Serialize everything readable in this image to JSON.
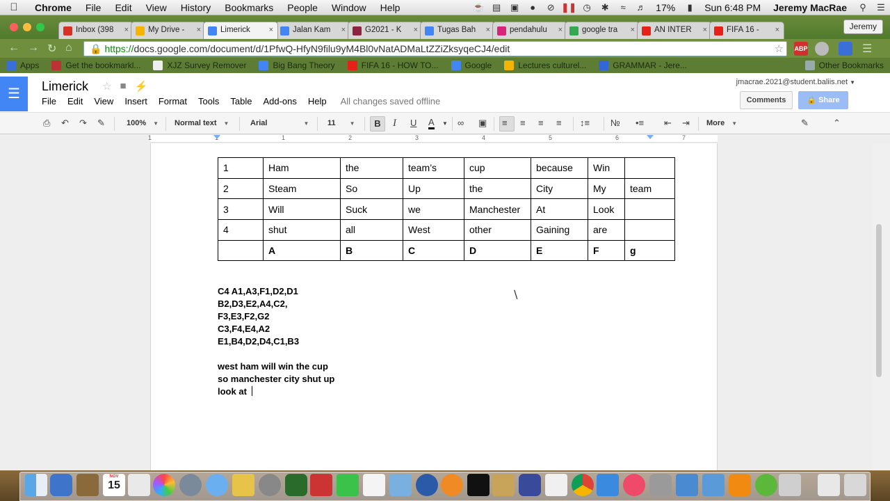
{
  "menubar": {
    "app": "Chrome",
    "items": [
      "File",
      "Edit",
      "View",
      "History",
      "Bookmarks",
      "People",
      "Window",
      "Help"
    ],
    "battery": "17%",
    "clock": "Sun 6:48 PM",
    "user": "Jeremy MacRae"
  },
  "tabs": [
    {
      "label": "Inbox (398",
      "color": "#d93025"
    },
    {
      "label": "My Drive -",
      "color": "#f4b400"
    },
    {
      "label": "Limerick",
      "color": "#4285f4"
    },
    {
      "label": "Jalan Kam",
      "color": "#4285f4"
    },
    {
      "label": "G2021 - K",
      "color": "#8e2442"
    },
    {
      "label": "Tugas Bah",
      "color": "#4285f4"
    },
    {
      "label": "pendahulu",
      "color": "#d8247b"
    },
    {
      "label": "google tra",
      "color": "#34a853"
    },
    {
      "label": "AN INTER",
      "color": "#e62117"
    },
    {
      "label": "FIFA 16 - ",
      "color": "#e62117"
    }
  ],
  "profile_button": "Jeremy",
  "address": {
    "scheme": "https://",
    "rest": "docs.google.com/document/d/1PfwQ-HfyN9filu9yM4Bl0vNatADMaLtZZiZksyqeCJ4/edit",
    "ext_abp": "ABP"
  },
  "bookmarks": [
    {
      "label": "Apps",
      "color": "#3a6fd8"
    },
    {
      "label": "Get the bookmarkl...",
      "color": "#b33"
    },
    {
      "label": "XJZ Survey Remover",
      "color": "#eee"
    },
    {
      "label": "Big Bang Theory",
      "color": "#4285f4"
    },
    {
      "label": "FIFA 16 - HOW TO...",
      "color": "#e62117"
    },
    {
      "label": "Google",
      "color": "#4285f4"
    },
    {
      "label": "Lectures culturel...",
      "color": "#f4b400"
    },
    {
      "label": "GRAMMAR - Jere...",
      "color": "#3367d6"
    },
    {
      "label": "Other Bookmarks",
      "color": "#9aa"
    }
  ],
  "docs": {
    "title": "Limerick",
    "menu": [
      "File",
      "Edit",
      "View",
      "Insert",
      "Format",
      "Tools",
      "Table",
      "Add-ons",
      "Help"
    ],
    "saved_status": "All changes saved offline",
    "account": "jmacrae.2021@student.baliis.net",
    "comments_label": "Comments",
    "share_label": "Share"
  },
  "edit_toolbar": {
    "zoom": "100%",
    "style": "Normal text",
    "font": "Arial",
    "size": "11",
    "more": "More"
  },
  "ruler_numbers": [
    "1",
    "1",
    "1",
    "2",
    "3",
    "4",
    "5",
    "6",
    "7"
  ],
  "table": {
    "rows": [
      [
        "1",
        "Ham",
        "the",
        "team’s",
        "cup",
        " because",
        "Win",
        ""
      ],
      [
        "2",
        "Steam",
        "So",
        "Up",
        "the",
        "City",
        "My",
        "team"
      ],
      [
        "3",
        "Will",
        "Suck",
        "we",
        "Manchester",
        "At",
        "Look",
        ""
      ],
      [
        "4",
        "shut",
        "all",
        "West",
        "other",
        "Gaining",
        "are",
        ""
      ],
      [
        "",
        "A",
        "B",
        "C",
        "D",
        "E",
        "F",
        "g"
      ]
    ]
  },
  "doc_lines": [
    "C4 A1,A3,F1,D2,D1",
    "B2,D3,E2,A4,C2,",
    "F3,E3,F2,G2",
    "C3,F4,E4,A2",
    "E1,B4,D2,D4,C1,B3",
    "",
    "west ham will win the cup",
    "so manchester city shut up",
    "look at "
  ],
  "dock": {
    "calendar_month": "NOV",
    "calendar_day": "15"
  }
}
